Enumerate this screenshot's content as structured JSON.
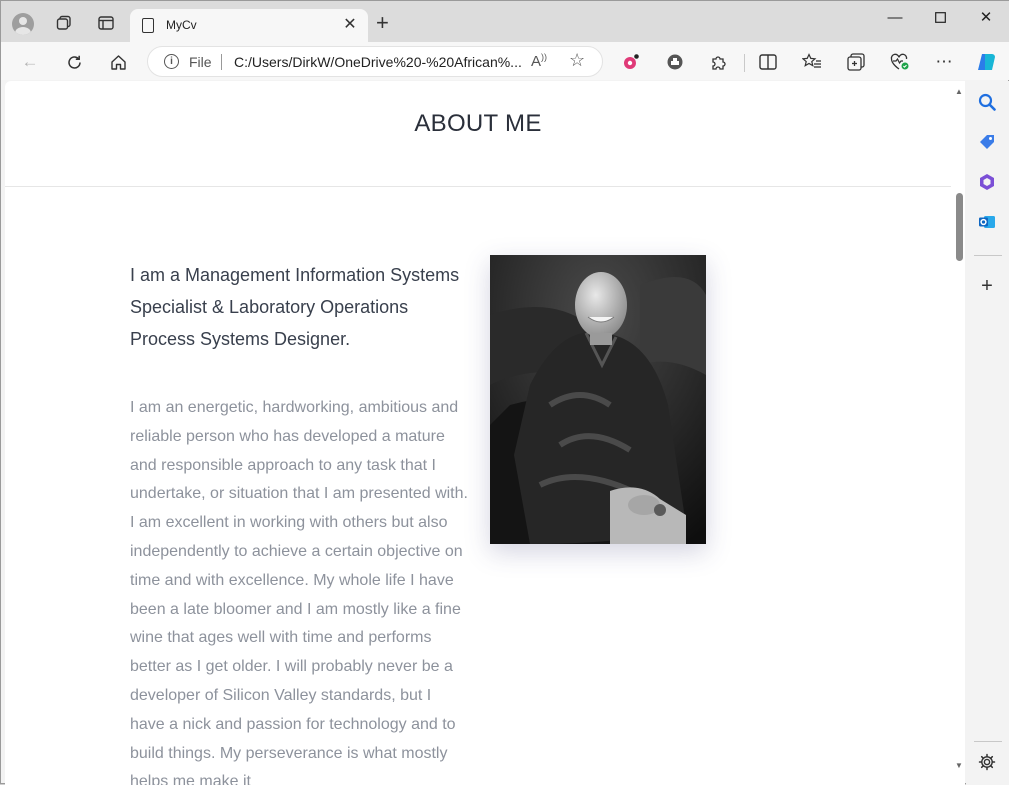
{
  "browser": {
    "tab": {
      "title": "MyCv"
    },
    "address": {
      "scheme_label": "File",
      "url": "C:/Users/DirkW/OneDrive%20-%20African%..."
    },
    "accent_color": "#1a73e8"
  },
  "page": {
    "heading": "ABOUT ME",
    "lead": "I am a Management Information Systems Specialist & Laboratory Operations Process Systems Designer.",
    "bio": "I am an energetic, hardworking, ambitious and reliable person who has developed a mature and responsible approach to any task that I undertake, or situation that I am presented with. I am excellent in working with others but also independently to achieve a certain objective on time and with excellence. My whole life I have been a late bloomer and I am mostly like a fine wine that ages well with time and performs better as I get older. I will probably never be a developer of Silicon Valley standards, but I have a nick and passion for technology and to build things. My perseverance is what mostly helps me make it"
  },
  "icons": [
    "profile-avatar",
    "workspaces-icon",
    "tab-actions-icon",
    "page-icon",
    "close-icon",
    "new-tab-icon",
    "minimize-icon",
    "maximize-icon",
    "window-close-icon",
    "back-icon",
    "refresh-icon",
    "home-icon",
    "info-icon",
    "read-aloud-icon",
    "favorite-star-icon",
    "extension-icon",
    "puzzle-icon",
    "split-screen-icon",
    "favorites-icon",
    "collections-icon",
    "health-icon",
    "more-icon",
    "copilot-icon",
    "search-icon",
    "shopping-tag-icon",
    "office-icon",
    "outlook-icon",
    "add-icon",
    "settings-icon"
  ]
}
